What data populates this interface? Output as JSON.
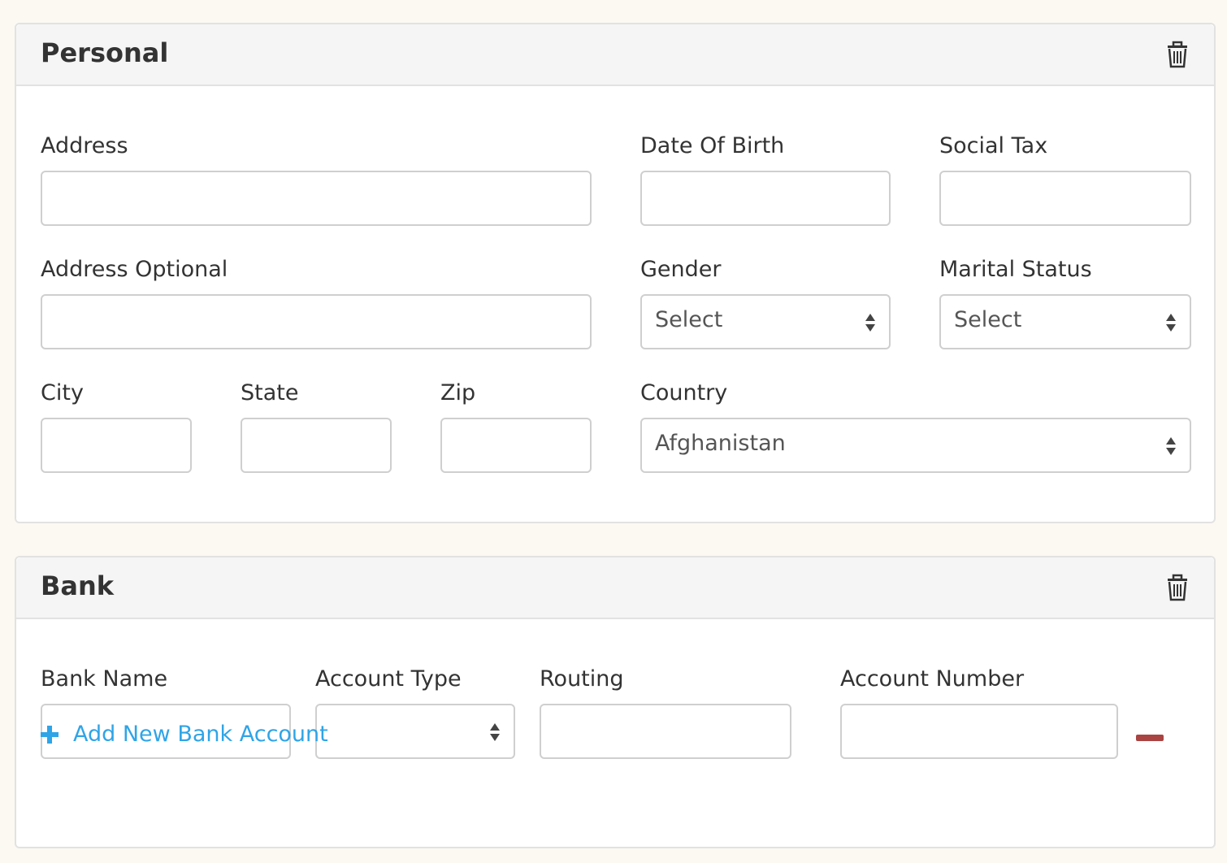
{
  "personal": {
    "title": "Personal",
    "delete_icon": "trash-icon",
    "fields": {
      "address": {
        "label": "Address",
        "value": ""
      },
      "date_of_birth": {
        "label": "Date Of Birth",
        "value": ""
      },
      "social_tax": {
        "label": "Social Tax",
        "value": ""
      },
      "address_optional": {
        "label": "Address Optional",
        "value": ""
      },
      "gender": {
        "label": "Gender",
        "selected": "Select"
      },
      "marital_status": {
        "label": "Marital Status",
        "selected": "Select"
      },
      "city": {
        "label": "City",
        "value": ""
      },
      "state": {
        "label": "State",
        "value": ""
      },
      "zip": {
        "label": "Zip",
        "value": ""
      },
      "country": {
        "label": "Country",
        "selected": "Afghanistan"
      }
    }
  },
  "bank": {
    "title": "Bank",
    "delete_icon": "trash-icon",
    "fields": {
      "bank_name": {
        "label": "Bank Name",
        "value": ""
      },
      "account_type": {
        "label": "Account Type",
        "selected": ""
      },
      "routing": {
        "label": "Routing",
        "value": ""
      },
      "account_number": {
        "label": "Account Number",
        "value": ""
      }
    },
    "remove_icon": "minus-icon",
    "add_link": "Add New Bank Account"
  },
  "colors": {
    "page_bg": "#fcf9f2",
    "panel_header_bg": "#f5f5f5",
    "link": "#2fa4e7",
    "remove": "#a94442"
  }
}
